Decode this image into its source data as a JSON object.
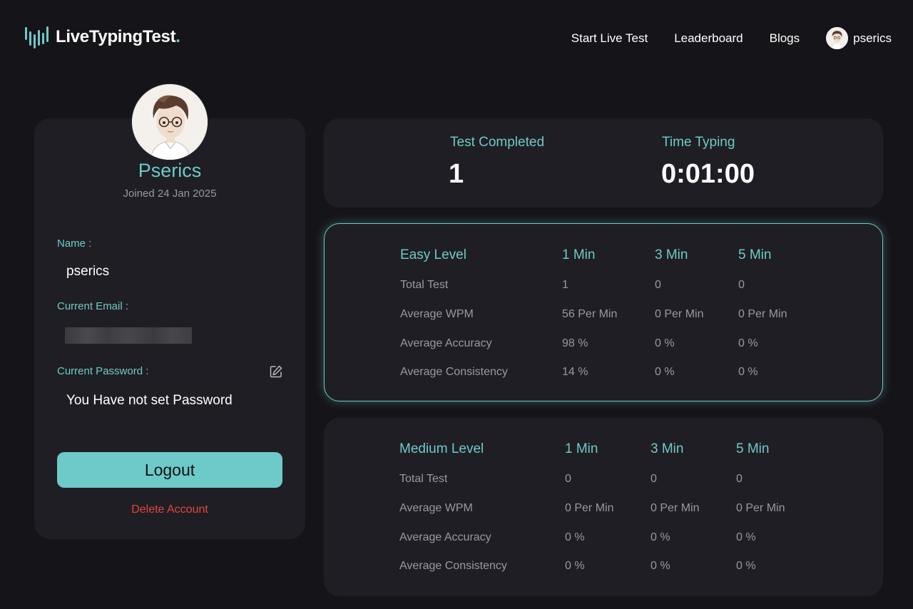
{
  "header": {
    "logo_text": "LiveTypingTest",
    "logo_dot": ".",
    "nav": [
      "Start Live Test",
      "Leaderboard",
      "Blogs"
    ],
    "username": "pserics"
  },
  "profile": {
    "display_name": "Pserics",
    "joined": "Joined 24 Jan 2025",
    "name_label": "Name :",
    "name_value": "pserics",
    "email_label": "Current Email :",
    "password_label": "Current Password :",
    "password_value": "You Have not set Password",
    "logout_label": "Logout",
    "delete_label": "Delete Account"
  },
  "summary": {
    "tests_label": "Test Completed",
    "tests_value": "1",
    "time_label": "Time Typing",
    "time_value": "0:01:00"
  },
  "levels": [
    {
      "title": "Easy Level",
      "columns": [
        "1 Min",
        "3 Min",
        "5 Min"
      ],
      "rows": [
        {
          "label": "Total Test",
          "values": [
            "1",
            "0",
            "0"
          ]
        },
        {
          "label": "Average WPM",
          "values": [
            "56 Per Min",
            "0 Per Min",
            "0 Per Min"
          ]
        },
        {
          "label": "Average Accuracy",
          "values": [
            "98 %",
            "0 %",
            "0 %"
          ]
        },
        {
          "label": "Average Consistency",
          "values": [
            "14 %",
            "0 %",
            "0 %"
          ]
        }
      ]
    },
    {
      "title": "Medium Level",
      "columns": [
        "1 Min",
        "3 Min",
        "5 Min"
      ],
      "rows": [
        {
          "label": "Total Test",
          "values": [
            "0",
            "0",
            "0"
          ]
        },
        {
          "label": "Average WPM",
          "values": [
            "0 Per Min",
            "0 Per Min",
            "0 Per Min"
          ]
        },
        {
          "label": "Average Accuracy",
          "values": [
            "0 %",
            "0 %",
            "0 %"
          ]
        },
        {
          "label": "Average Consistency",
          "values": [
            "0 %",
            "0 %",
            "0 %"
          ]
        }
      ]
    }
  ],
  "colors": {
    "background": "#151419",
    "card": "#1f1e24",
    "accent": "#6ecac8",
    "muted_text": "#9a999f",
    "danger": "#e0473e"
  }
}
